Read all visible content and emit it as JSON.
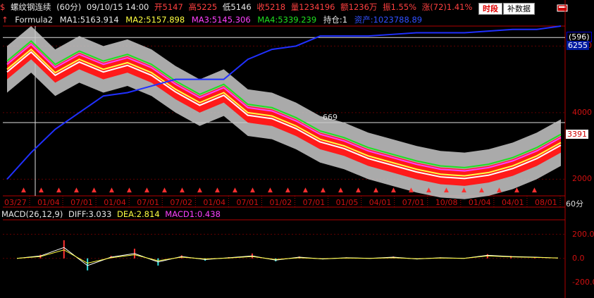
{
  "header": {
    "symbol_icon": "stock-symbol-icon",
    "name": "螺纹钢连续",
    "period": "(60分)",
    "datetime": "09/10/15 14:00",
    "open": "开5147",
    "high": "高5225",
    "low": "低5146",
    "close": "收5218",
    "volume": "量1234196",
    "amount": "额1236万",
    "amplitude": "振1.55%",
    "change": "涨(72)1.41%",
    "period_button": "时段",
    "fill_button": "补数据",
    "tool_icon": "toolbox-icon"
  },
  "indicator_line": {
    "arrow_icon": "up-arrow-icon",
    "formula": "Formula2",
    "ma1": "MA1:5163.914",
    "ma2": "MA2:5157.898",
    "ma3": "MA3:5145.306",
    "ma4": "MA4:5339.239",
    "position": "持仓:1",
    "asset": "资产:1023788.89"
  },
  "macd_line": {
    "name": "MACD(26,12,9)",
    "diff": "DIFF:3.033",
    "dea": "DEA:2.814",
    "macd1": "MACD1:0.438"
  },
  "price_axis": {
    "tags": [
      "(596)",
      "6255",
      "3391"
    ],
    "annotation": "669"
  },
  "period_label": "60分",
  "colors": {
    "up": "#ff2020",
    "down": "#e8e8e8",
    "ma1": "#ffffff",
    "ma2": "#ffff40",
    "ma3": "#ff40ff",
    "ma4": "#20e020",
    "asset": "#2030ff",
    "axis": "#b00000"
  },
  "chart_data": [
    {
      "type": "line",
      "title": "螺纹钢连续 (60分)",
      "x": [
        "03/27",
        "01/04",
        "07/01",
        "01/04",
        "07/01",
        "07/02",
        "01/04",
        "07/01",
        "01/02",
        "07/01",
        "01/05",
        "04/01",
        "07/01",
        "10/08",
        "01/04",
        "04/01",
        "08/01"
      ],
      "y_ticks": [
        2000,
        4000,
        6000
      ],
      "ylim": [
        1500,
        6600
      ],
      "series": [
        {
          "name": "MA3",
          "values": [
            5300,
            5900,
            5200,
            5600,
            5300,
            5500,
            5200,
            4700,
            4300,
            4600,
            4000,
            3900,
            3600,
            3200,
            3000,
            2700,
            2500,
            2300,
            2150,
            2100,
            2200,
            2400,
            2700,
            3100
          ]
        },
        {
          "name": "资产",
          "values": [
            2000,
            2800,
            3500,
            4000,
            4500,
            4600,
            4800,
            5000,
            5000,
            5000,
            5600,
            5900,
            6000,
            6300,
            6300,
            6300,
            6350,
            6400,
            6400,
            6400,
            6450,
            6500,
            6500,
            6600
          ]
        }
      ],
      "horizontal_lines": [
        6255,
        3700
      ]
    },
    {
      "type": "bar",
      "title": "MACD(26,12,9)",
      "y_ticks": [
        -200,
        0,
        200
      ],
      "ylim": [
        -300,
        320
      ],
      "series": [
        {
          "name": "DIFF",
          "values": [
            0,
            20,
            90,
            -60,
            10,
            40,
            -30,
            15,
            -10,
            5,
            20,
            -15,
            10,
            -5,
            5,
            0,
            10,
            -5,
            5,
            0,
            25,
            15,
            10,
            3
          ]
        },
        {
          "name": "DEA",
          "values": [
            0,
            15,
            70,
            -40,
            5,
            30,
            -20,
            10,
            -5,
            3,
            15,
            -10,
            5,
            -3,
            3,
            0,
            5,
            -3,
            3,
            0,
            20,
            12,
            8,
            3
          ]
        },
        {
          "name": "MACD1",
          "values": [
            0,
            30,
            150,
            -100,
            20,
            80,
            -60,
            25,
            -20,
            10,
            40,
            -25,
            15,
            -8,
            8,
            0,
            15,
            -8,
            8,
            0,
            35,
            20,
            12,
            0.4
          ]
        }
      ]
    }
  ]
}
